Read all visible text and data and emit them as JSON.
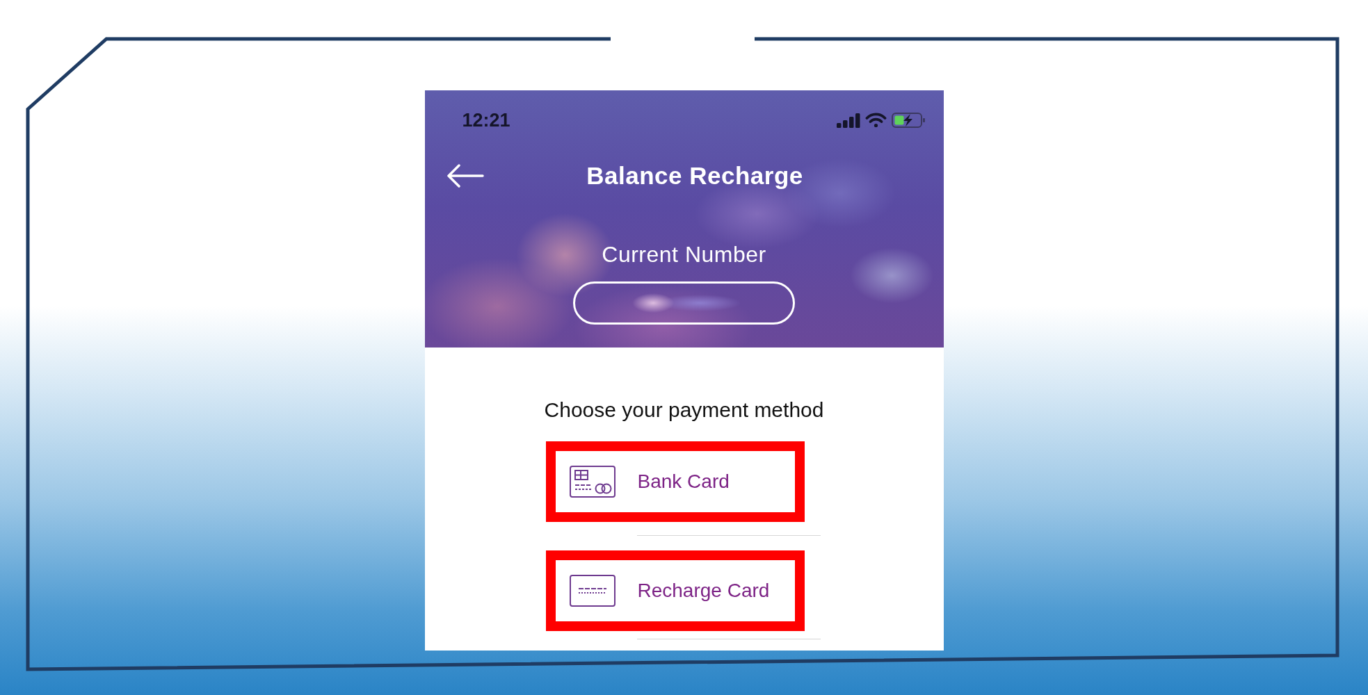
{
  "status_bar": {
    "time": "12:21"
  },
  "header": {
    "title": "Balance Recharge",
    "number_label": "Current Number"
  },
  "content": {
    "prompt": "Choose your payment method",
    "payment_methods": [
      {
        "kind": "bank_card",
        "label": "Bank Card",
        "highlighted": true
      },
      {
        "kind": "recharge_card",
        "label": "Recharge Card",
        "highlighted": true
      }
    ]
  }
}
